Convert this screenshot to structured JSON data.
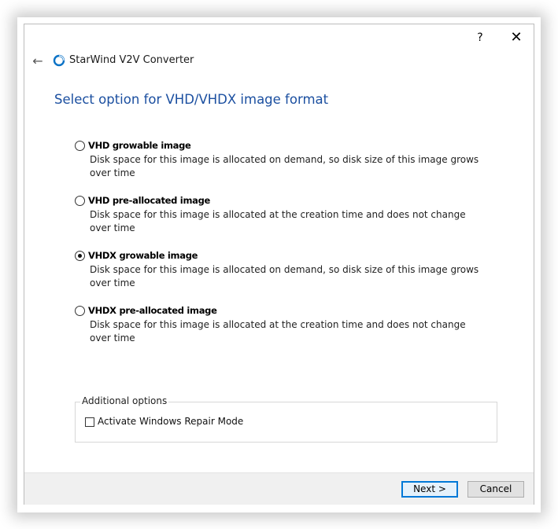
{
  "window": {
    "help_label": "?",
    "close_label": "✕",
    "back_label": "←"
  },
  "app": {
    "title": "StarWind V2V Converter"
  },
  "page": {
    "heading": "Select option for VHD/VHDX image format"
  },
  "options": [
    {
      "label": "VHD growable image",
      "description": "Disk space for this image is allocated on demand, so disk size of this image grows over time",
      "selected": false
    },
    {
      "label": "VHD pre-allocated image",
      "description": "Disk space for this image is allocated at the creation time and does not change over time",
      "selected": false
    },
    {
      "label": "VHDX growable image",
      "description": "Disk space for this image is allocated on demand, so disk size of this image grows over time",
      "selected": true
    },
    {
      "label": "VHDX pre-allocated image",
      "description": "Disk space for this image is allocated at the creation time and does not change over time",
      "selected": false
    }
  ],
  "additional": {
    "legend": "Additional options",
    "repair_mode_label": "Activate Windows Repair Mode",
    "repair_mode_checked": false
  },
  "footer": {
    "next_label": "Next >",
    "cancel_label": "Cancel"
  },
  "colors": {
    "heading": "#1b4fa0",
    "accent": "#0078d7"
  },
  "icons": {
    "back": "back-arrow-icon",
    "help": "help-icon",
    "close": "close-icon",
    "logo": "starwind-logo-icon"
  }
}
